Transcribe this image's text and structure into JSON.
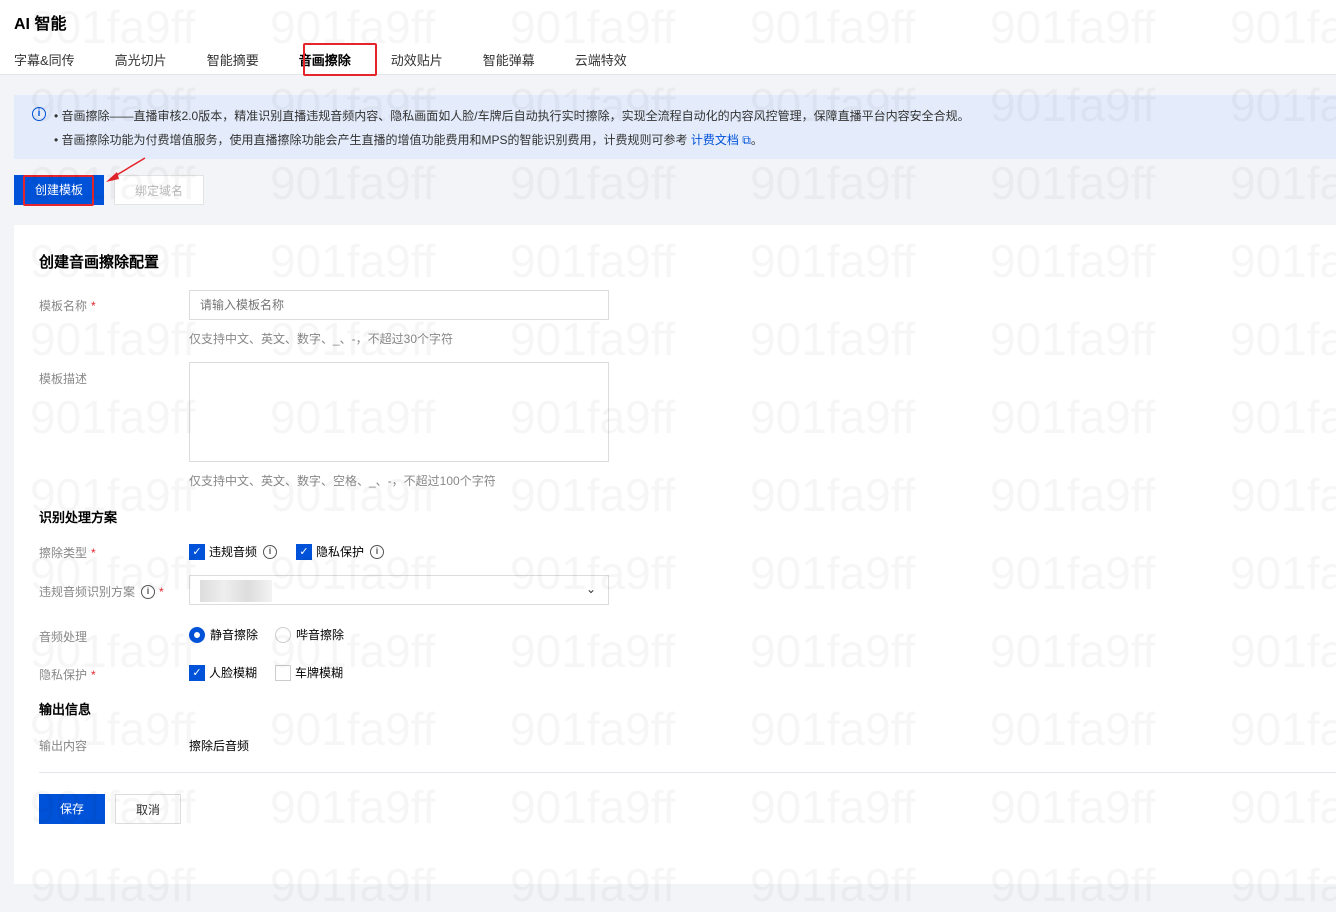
{
  "header": {
    "title": "AI 智能",
    "tabs": [
      "字幕&同传",
      "高光切片",
      "智能摘要",
      "音画擦除",
      "动效贴片",
      "智能弹幕",
      "云端特效"
    ]
  },
  "banner": {
    "line1": "音画擦除——直播审核2.0版本，精准识别直播违规音频内容、隐私画面如人脸/车牌后自动执行实时擦除，实现全流程自动化的内容风控管理，保障直播平台内容安全合规。",
    "line2": "音画擦除功能为付费增值服务，使用直播擦除功能会产生直播的增值功能费用和MPS的智能识别费用，计费规则可参考",
    "link": "计费文档",
    "line2_end": "。"
  },
  "toolbar": {
    "create": "创建模板",
    "bind": "绑定域名"
  },
  "form": {
    "title": "创建音画擦除配置",
    "name_label": "模板名称",
    "name_placeholder": "请输入模板名称",
    "name_hint": "仅支持中文、英文、数字、_、-，不超过30个字符",
    "desc_label": "模板描述",
    "desc_hint": "仅支持中文、英文、数字、空格、_、-，不超过100个字符",
    "section1": "识别处理方案",
    "erase_type_label": "擦除类型",
    "erase_types": [
      "违规音频",
      "隐私保护"
    ],
    "scheme_label": "违规音频识别方案",
    "audio_label": "音频处理",
    "audio_options": [
      "静音擦除",
      "哔音擦除"
    ],
    "privacy_label": "隐私保护",
    "privacy_options": [
      "人脸模糊",
      "车牌模糊"
    ],
    "section2": "输出信息",
    "output_label": "输出内容",
    "output_value": "擦除后音频",
    "save": "保存",
    "cancel": "取消"
  },
  "watermark": "901fa9ff"
}
